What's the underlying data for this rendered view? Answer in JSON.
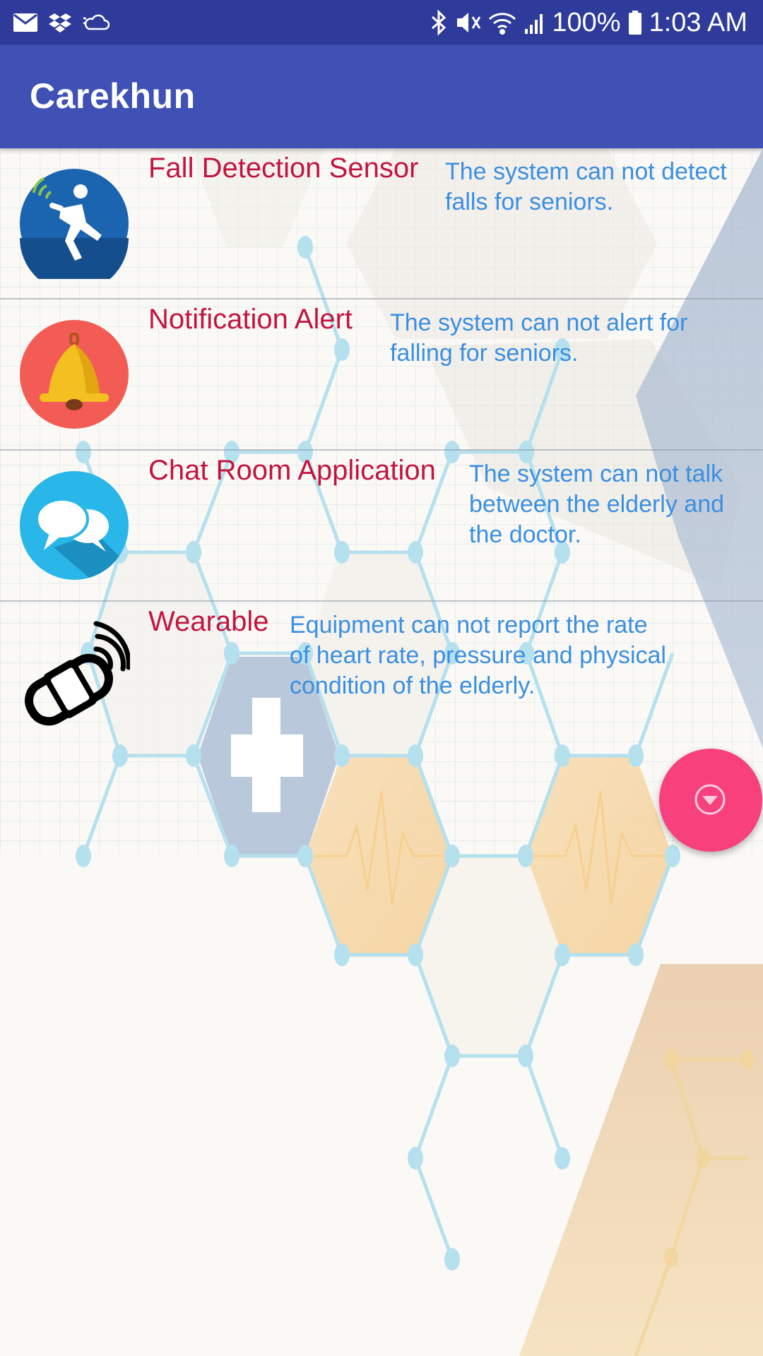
{
  "status_bar": {
    "battery": "100%",
    "time": "1:03 AM"
  },
  "app_bar": {
    "title": "Carekhun"
  },
  "features": [
    {
      "title": "Fall Detection Sensor",
      "description": "The system can not detect\nfalls for seniors.",
      "icon": "fall-detection-icon"
    },
    {
      "title": "Notification Alert",
      "description": "The system can not alert for\nfalling for seniors.",
      "icon": "bell-icon"
    },
    {
      "title": "Chat Room Application",
      "description": "The system can not talk\nbetween the elderly and\nthe doctor.",
      "icon": "chat-bubbles-icon"
    },
    {
      "title": "Wearable",
      "description": "Equipment can not report the rate\nof heart rate, pressure and physical\ncondition of the elderly.",
      "icon": "wearable-band-icon"
    }
  ],
  "fab": {
    "icon": "chevron-down-circle-icon"
  },
  "colors": {
    "status_bar": "#2f3b9a",
    "app_bar": "#3f51b5",
    "title_text": "#c3143f",
    "description_text": "#3b8fe0",
    "fab": "#f8407d"
  }
}
